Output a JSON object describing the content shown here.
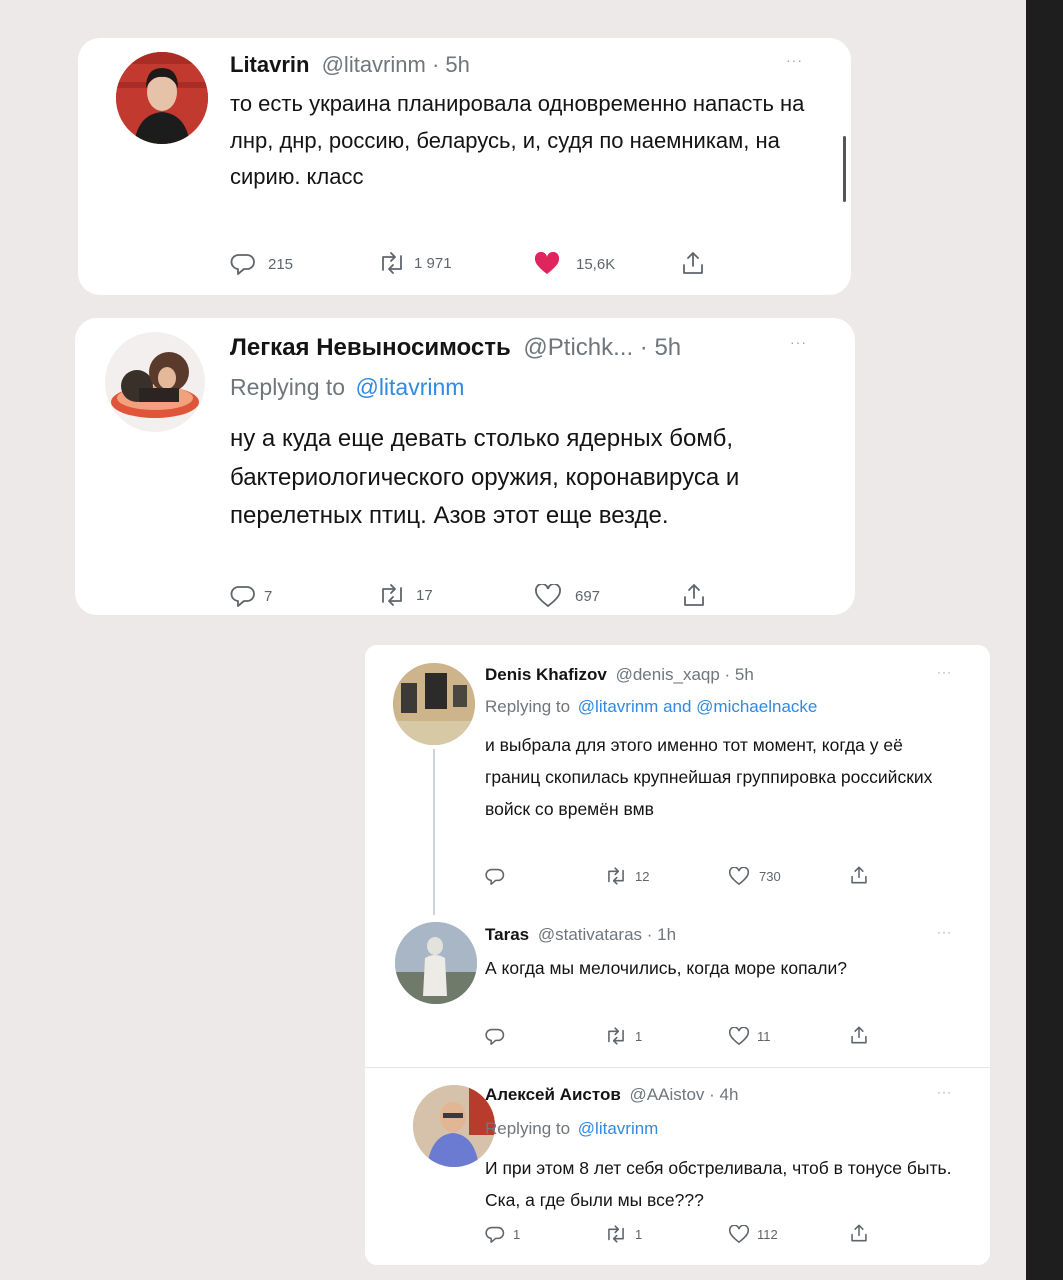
{
  "tweet1": {
    "name": "Litavrin",
    "meta": "@litavrinm · 5h",
    "text": "то есть украина планировала одновременно напасть на лнр, днр, россию, беларусь, и, судя по наемникам, на сирию. класс",
    "replies": "215",
    "retweets": "1 971",
    "likes": "15,6K"
  },
  "tweet2": {
    "name": "Легкая Невыносимость",
    "meta": "@Ptichk... · 5h",
    "replying_prefix": "Replying to",
    "replying_to": "@litavrinm",
    "text": "ну а куда еще девать столько ядерных бомб, бактериологического оружия, коронавируса и перелетных птиц. Азов этот еще везде.",
    "replies": "7",
    "retweets": "17",
    "likes": "697"
  },
  "tweet3": {
    "name": "Denis Khafizov",
    "meta": "@denis_xaqp · 5h",
    "replying_prefix": "Replying to",
    "replying_to": "@litavrinm and @michaelnacke",
    "text": "и выбрала для этого именно тот момент, когда у её границ скопилась крупнейшая группировка российских войск со времён вмв",
    "replies": "",
    "retweets": "12",
    "likes": "730"
  },
  "tweet4": {
    "name": "Taras",
    "meta": "@stativataras · 1h",
    "text": "А когда мы мелочились, когда море копали?",
    "replies": "",
    "retweets": "1",
    "likes": "11"
  },
  "tweet5": {
    "name": "Алексей Аистов",
    "meta": "@AAistov · 4h",
    "replying_prefix": "Replying to",
    "replying_to": "@litavrinm",
    "text": "И при этом 8 лет себя обстреливала, чтоб в тонусе быть. Ска, а где были мы все???",
    "replies": "1",
    "retweets": "1",
    "likes": "112"
  },
  "more_label": "···",
  "colors": {
    "like_active": "#e0245e",
    "link": "#2f8ae0",
    "muted": "#6f767c"
  }
}
